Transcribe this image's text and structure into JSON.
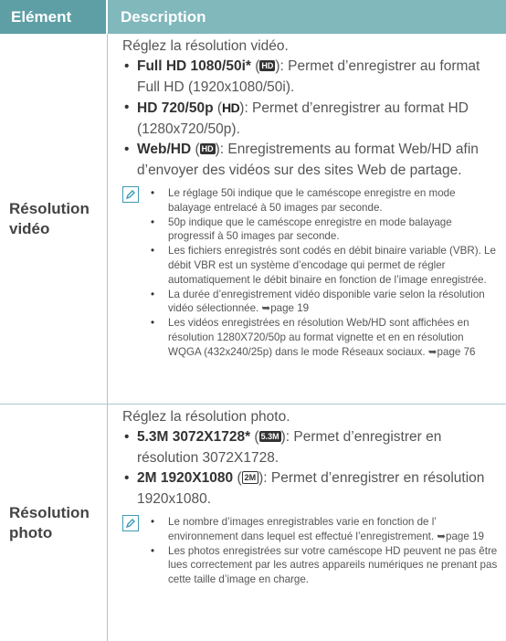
{
  "header": {
    "col1": "Elément",
    "col2": "Description"
  },
  "video": {
    "label_line1": "Résolution",
    "label_line2": "vidéo",
    "intro": "Réglez la résolution vidéo.",
    "items": [
      {
        "bold": "Full HD 1080/50i*",
        "badge": "HD",
        "text": "): Permet d’enregistrer au format Full HD (1920x1080/50i)."
      },
      {
        "bold": "HD 720/50p",
        "badge": "HD",
        "text": "): Permet d’enregistrer au format HD (1280x720/50p)."
      },
      {
        "bold": "Web/HD",
        "badge": "HD",
        "text": "): Enregistrements au format Web/HD afin d’envoyer des vidéos sur des sites Web de partage."
      }
    ],
    "notes": [
      "Le réglage 50i indique que le caméscope enregistre en mode balayage entrelacé à 50 images par seconde.",
      "50p indique que le caméscope enregistre en mode balayage progressif à 50 images par seconde.",
      "Les fichiers enregistrés sont codés en débit binaire variable (VBR). Le débit VBR est un système d’encodage qui permet de régler automatiquement le débit binaire en fonction de l’image enregistrée.",
      "La durée d’enregistrement vidéo disponible varie selon la résolution vidéo sélectionnée. ➥page 19",
      "Les vidéos enregistrées en résolution Web/HD sont affichées en résolution 1280X720/50p au format vignette et en en résolution WQGA (432x240/25p) dans le mode Réseaux sociaux. ➥page 76"
    ]
  },
  "photo": {
    "label_line1": "Résolution",
    "label_line2": "photo",
    "intro": "Réglez la résolution photo.",
    "items": [
      {
        "bold": "5.3M 3072X1728*",
        "badge": "5.3M",
        "text": "): Permet d’enregistrer en résolution 3072X1728."
      },
      {
        "bold": "2M 1920X1080",
        "badge": "2M",
        "text": "): Permet d’enregistrer en résolution 1920x1080."
      }
    ],
    "notes": [
      "Le nombre d’images enregistrables varie en fonction de l’ environnement dans lequel est effectué l’enregistrement. ➥page 19",
      "Les photos enregistrées sur votre caméscope HD peuvent ne pas être lues correctement par les autres appareils numériques ne prenant pas cette taille d’image en charge."
    ]
  },
  "note_icon": "memo-icon",
  "colors": {
    "header_dark": "#5d9fa5",
    "header_light": "#80b8bc",
    "rule": "#a9c9cc",
    "note_icon": "#3e9ab4"
  }
}
